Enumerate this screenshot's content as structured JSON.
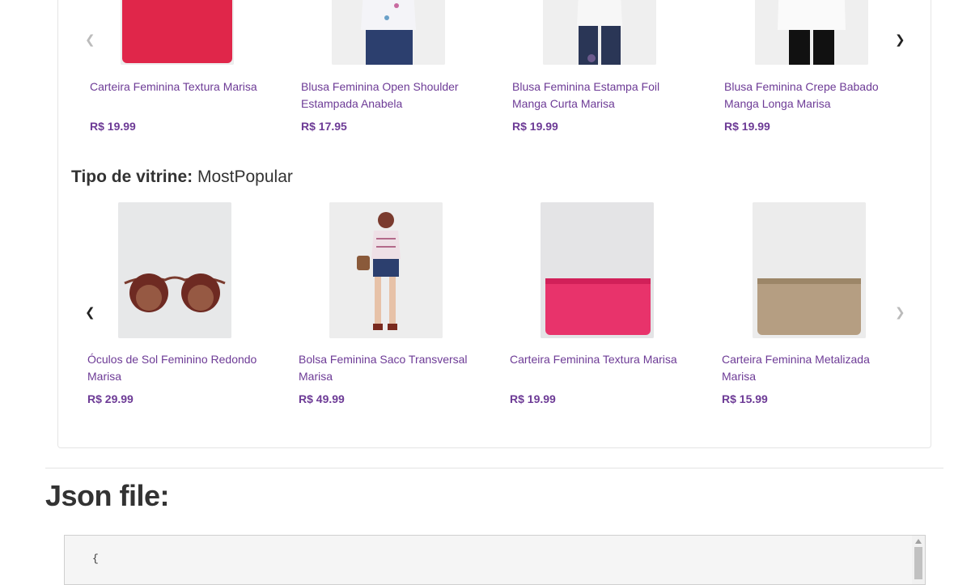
{
  "shelf1": {
    "products": [
      {
        "name": "Carteira Feminina Textura Marisa",
        "price": "R$ 19.99",
        "image": "red-wallet"
      },
      {
        "name": "Blusa Feminina Open Shoulder Estampada Anabela",
        "price": "R$ 17.95",
        "image": "printed-blouse"
      },
      {
        "name": "Blusa Feminina Estampa Foil Manga Curta Marisa",
        "price": "R$ 19.99",
        "image": "white-tee"
      },
      {
        "name": "Blusa Feminina Crepe Babado Manga Longa Marisa",
        "price": "R$ 19.99",
        "image": "white-longsleeve"
      }
    ],
    "prev_icon": "chevron-left-icon",
    "next_icon": "chevron-right-icon"
  },
  "shelf2": {
    "title_label": "Tipo de vitrine:",
    "title_value": "MostPopular",
    "products": [
      {
        "name": "Óculos de Sol Feminino Redondo Marisa",
        "price": "R$ 29.99",
        "image": "sunglasses"
      },
      {
        "name": "Bolsa Feminina Saco Transversal Marisa",
        "price": "R$ 49.99",
        "image": "woman-with-bag"
      },
      {
        "name": "Carteira Feminina Textura Marisa",
        "price": "R$ 19.99",
        "image": "pink-wallet"
      },
      {
        "name": "Carteira Feminina Metalizada Marisa",
        "price": "R$ 15.99",
        "image": "gold-wallet"
      }
    ],
    "prev_icon": "chevron-left-icon",
    "next_icon": "chevron-right-icon"
  },
  "json_section": {
    "title": "Json file:",
    "first_line": "{"
  },
  "colors": {
    "accent": "#6d3b96",
    "wallet_red": "#e0264a",
    "wallet_pink": "#e8336b",
    "wallet_gold": "#b59e82"
  }
}
